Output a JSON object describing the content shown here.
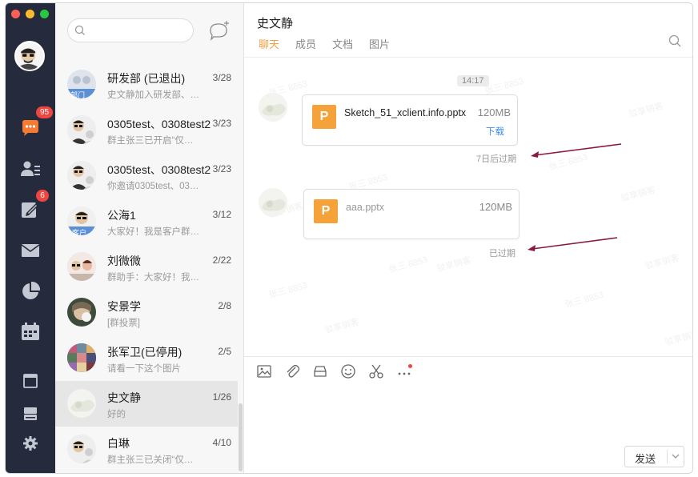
{
  "search": {
    "placeholder": ""
  },
  "nav": {
    "chat_badge": "95",
    "tasks_badge": "6"
  },
  "conversations": [
    {
      "name": "研发部 (已退出)",
      "date": "3/28",
      "preview": "史文静加入研发部、…",
      "tag": "部门"
    },
    {
      "name": "0305test、0308test2",
      "date": "3/23",
      "preview": "群主张三已开启“仅…",
      "tag": ""
    },
    {
      "name": "0305test、0308test2",
      "date": "3/23",
      "preview": "你邀请0305test、03…",
      "tag": ""
    },
    {
      "name": "公海1",
      "date": "3/12",
      "preview": "大家好！我是客户群…",
      "tag": "客户"
    },
    {
      "name": "刘微微",
      "date": "2/22",
      "preview": "群助手：大家好！我…",
      "tag": ""
    },
    {
      "name": "安景学",
      "date": "2/8",
      "preview": "[群投票]",
      "tag": ""
    },
    {
      "name": "张军卫(已停用)",
      "date": "2/5",
      "preview": "请看一下这个图片",
      "tag": ""
    },
    {
      "name": "史文静",
      "date": "1/26",
      "preview": "好的",
      "tag": ""
    },
    {
      "name": "白琳",
      "date": "4/10",
      "preview": "群主张三已关闭“仅…",
      "tag": ""
    }
  ],
  "chat": {
    "title": "史文静",
    "tabs": [
      "聊天",
      "成员",
      "文档",
      "图片"
    ],
    "time": "14:17",
    "messages": [
      {
        "file_name": "Sketch_51_xclient.info.pptx",
        "size": "120MB",
        "action": "下载",
        "status": "7日后过期",
        "icon_letter": "P"
      },
      {
        "file_name": "aaa.pptx",
        "size": "120MB",
        "action": "",
        "status": "已过期",
        "icon_letter": "P"
      }
    ],
    "watermark": [
      "张三 8853",
      "驳享销客"
    ],
    "send_label": "发送"
  },
  "colors": {
    "accent": "#f5a142",
    "rail": "#252b3c",
    "badge": "#f0463f",
    "link": "#3d8ef0",
    "arrow": "#8b1a3c"
  }
}
